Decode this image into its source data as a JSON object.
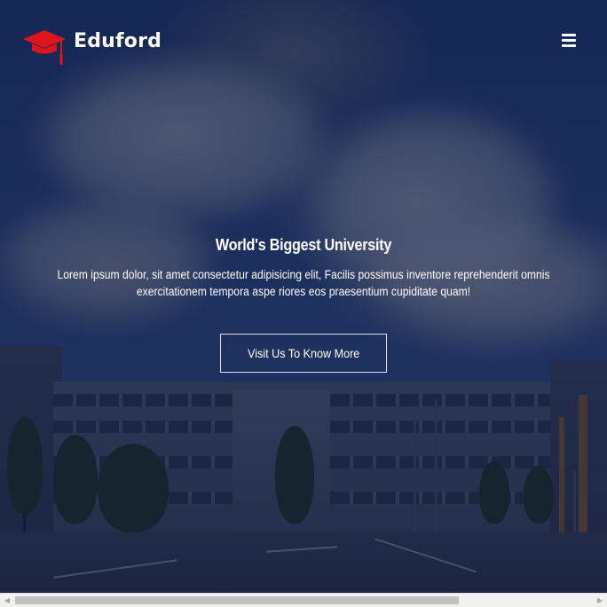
{
  "brand": {
    "name": "Eduford",
    "logo_icon": "graduation-cap-icon",
    "accent_color": "#e0151b"
  },
  "nav": {
    "menu_icon": "hamburger-menu-icon"
  },
  "hero": {
    "title": "World's Biggest University",
    "description": "Lorem ipsum dolor, sit amet consectetur adipisicing elit, Facilis possimus inventore reprehenderit omnis exercitationem tempora aspe riores eos praesentium cupiditate quam!",
    "cta_label": "Visit Us To Know More",
    "overlay_color": "#0e1a3a"
  },
  "scrollbar": {
    "left_arrow": "◀",
    "right_arrow": "▶",
    "thumb_fraction": 0.74
  }
}
